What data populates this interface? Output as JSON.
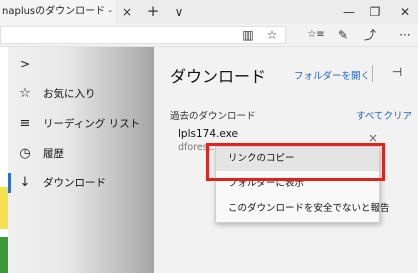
{
  "titlebar": {
    "tab_title": "naplusのダウンロード - 窓",
    "tab_close_glyph": "×",
    "new_tab_glyph": "+",
    "tab_dropdown_glyph": "∨",
    "minimize_glyph": "—",
    "restore_glyph": "❐",
    "close_glyph": "✕"
  },
  "toolbar": {
    "icons": [
      "reading-view-icon",
      "favorite-star-icon",
      "hub-icon",
      "web-note-icon",
      "share-icon",
      "more-icon"
    ],
    "reading_view_glyph": "▥",
    "star_glyph": "☆",
    "hub_glyph": "☆≡",
    "note_glyph": "✎",
    "share_glyph": "⤴",
    "more_glyph": "···"
  },
  "hub": {
    "collapse_glyph": ">",
    "items": [
      {
        "icon": "star-icon",
        "glyph": "☆",
        "label": "お気に入り"
      },
      {
        "icon": "reading-list-icon",
        "glyph": "≡",
        "label": "リーディング リスト"
      },
      {
        "icon": "history-icon",
        "glyph": "◷",
        "label": "履歴"
      },
      {
        "icon": "download-icon",
        "glyph": "↓",
        "label": "ダウンロード",
        "active": true
      }
    ],
    "accent_color": "#2b6ed6"
  },
  "downloads": {
    "title": "ダウンロード",
    "open_folder": "フォルダーを開く",
    "pin_glyph": "⊣",
    "section_label": "過去のダウンロード",
    "clear_all": "すべてクリア",
    "file_name": "lpls174.exe",
    "file_source": "dforest.w",
    "file_remove_glyph": "×"
  },
  "context_menu": {
    "items": [
      {
        "label": "リンクのコピー",
        "highlighted": true
      },
      {
        "label": "フォルダーに表示"
      },
      {
        "label": "このダウンロードを安全でないと報告"
      }
    ],
    "highlight_border_color": "#e0231b"
  }
}
